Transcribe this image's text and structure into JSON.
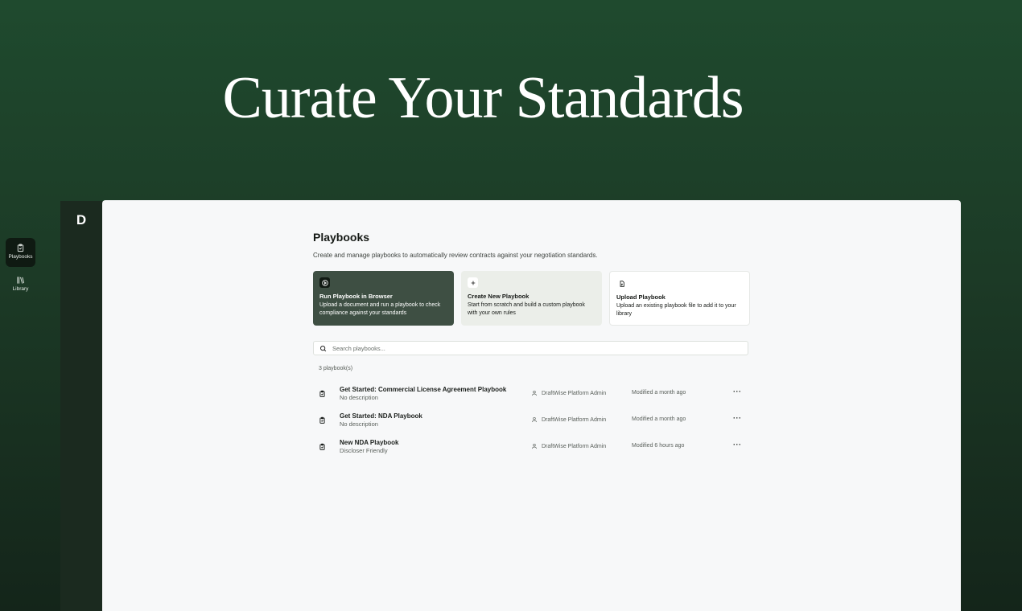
{
  "hero": {
    "title": "Curate Your Standards"
  },
  "sidebar": {
    "logo": "D",
    "items": [
      {
        "label": "Playbooks",
        "icon": "clipboard-check-icon",
        "active": true
      },
      {
        "label": "Library",
        "icon": "books-icon",
        "active": false
      }
    ]
  },
  "main": {
    "title": "Playbooks",
    "subtitle": "Create and manage playbooks to automatically review contracts against your negotiation standards.",
    "cards": [
      {
        "title": "Run Playbook in Browser",
        "description": "Upload a document and run a playbook to check compliance against your standards",
        "icon": "play-icon"
      },
      {
        "title": "Create New Playbook",
        "description": "Start from scratch and build a custom playbook with your own rules",
        "icon": "plus-icon"
      },
      {
        "title": "Upload Playbook",
        "description": "Upload an existing playbook file to add it to your library",
        "icon": "file-icon"
      }
    ],
    "search": {
      "placeholder": "Search playbooks..."
    },
    "count": "3 playbook(s)",
    "playbooks": [
      {
        "title": "Get Started: Commercial License Agreement Playbook",
        "description": "No description",
        "owner": "DraftWise Platform Admin",
        "modified": "Modified a month ago"
      },
      {
        "title": "Get Started: NDA Playbook",
        "description": "No description",
        "owner": "DraftWise Platform Admin",
        "modified": "Modified a month ago"
      },
      {
        "title": "New NDA Playbook",
        "description": "Discloser Friendly",
        "owner": "DraftWise Platform Admin",
        "modified": "Modified 6 hours ago"
      }
    ],
    "more_label": "···"
  },
  "colors": {
    "background": "#1f4a2e",
    "sidebar": "#1b2a1f",
    "primary_card": "#3e4f43",
    "panel": "#f7f8f9"
  }
}
